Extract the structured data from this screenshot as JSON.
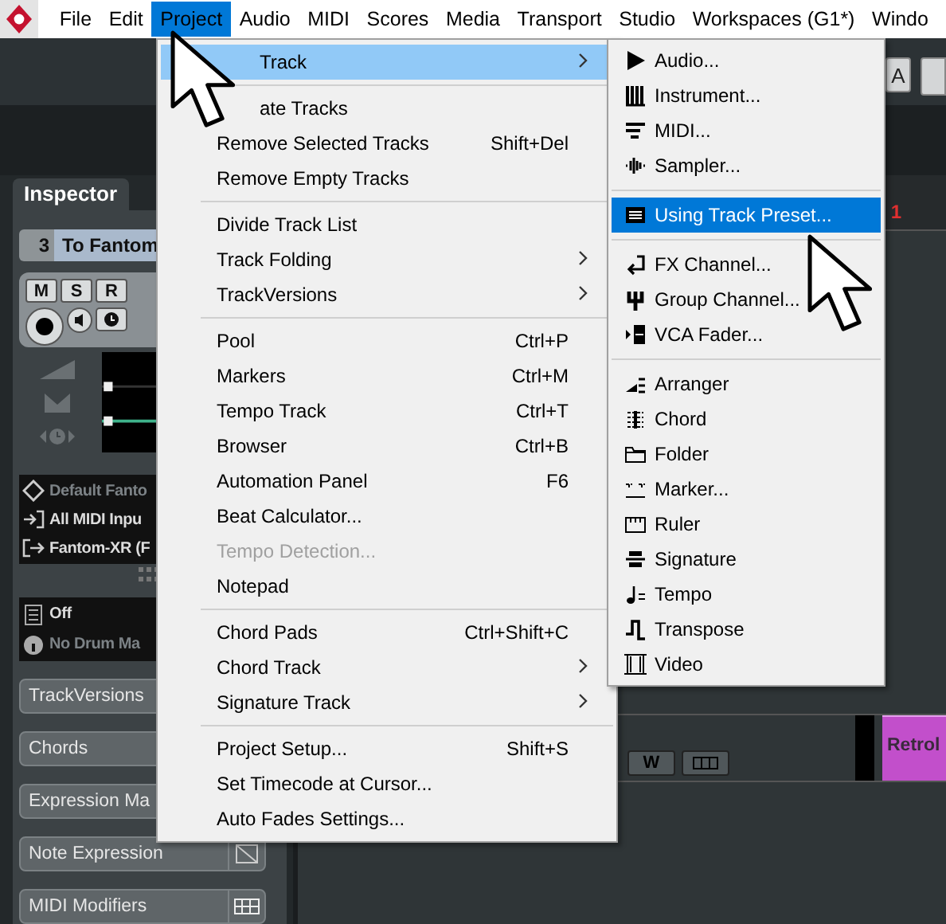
{
  "menu_bar": [
    {
      "label": "File",
      "selected": false
    },
    {
      "label": "Edit",
      "selected": false
    },
    {
      "label": "Project",
      "selected": true
    },
    {
      "label": "Audio",
      "selected": false
    },
    {
      "label": "MIDI",
      "selected": false
    },
    {
      "label": "Scores",
      "selected": false
    },
    {
      "label": "Media",
      "selected": false
    },
    {
      "label": "Transport",
      "selected": false
    },
    {
      "label": "Studio",
      "selected": false
    },
    {
      "label": "Workspaces (G1*)",
      "selected": false
    },
    {
      "label": "Windo",
      "selected": false
    }
  ],
  "toolbar": {
    "buttons": [
      "A"
    ]
  },
  "inspector": {
    "tabs": [
      {
        "label": "Inspector",
        "selected": true
      }
    ],
    "track": {
      "number": "3",
      "name": "To Fantom"
    },
    "channel_buttons": [
      "M",
      "S",
      "R"
    ],
    "routing": [
      {
        "label": "Default Fanto",
        "disabled": true
      },
      {
        "label": "All MIDI Inpu",
        "disabled": false
      },
      {
        "label": "Fantom-XR (F",
        "disabled": false
      }
    ],
    "drum": [
      {
        "label": "Off",
        "disabled": false
      },
      {
        "label": "No Drum Ma",
        "disabled": true
      }
    ],
    "sections": [
      {
        "label": "TrackVersions",
        "kind": "plain"
      },
      {
        "label": "Chords",
        "kind": "plain"
      },
      {
        "label": "Expression Ma",
        "kind": "plain"
      },
      {
        "label": "Note Expression",
        "kind": "hatch"
      },
      {
        "label": "MIDI Modifiers",
        "kind": "grid"
      }
    ]
  },
  "ruler": {
    "marks": [
      "1"
    ]
  },
  "track_row": {
    "buttons": [
      "W"
    ]
  },
  "clip": {
    "label": "Retrol"
  },
  "project_menu": [
    {
      "kind": "item",
      "label": "Track",
      "submenu": true,
      "selected": true,
      "disabled": false,
      "covered": true
    },
    {
      "kind": "separator"
    },
    {
      "kind": "item",
      "label": "ate Tracks",
      "selected": false,
      "disabled": false,
      "covered": true
    },
    {
      "kind": "item",
      "label": "Remove Selected Tracks",
      "shortcut": "Shift+Del",
      "selected": false,
      "disabled": false
    },
    {
      "kind": "item",
      "label": "Remove Empty Tracks",
      "selected": false,
      "disabled": false
    },
    {
      "kind": "separator"
    },
    {
      "kind": "item",
      "label": "Divide Track List",
      "selected": false,
      "disabled": false
    },
    {
      "kind": "item",
      "label": "Track Folding",
      "submenu": true,
      "selected": false,
      "disabled": false
    },
    {
      "kind": "item",
      "label": "TrackVersions",
      "submenu": true,
      "selected": false,
      "disabled": false
    },
    {
      "kind": "separator"
    },
    {
      "kind": "item",
      "label": "Pool",
      "shortcut": "Ctrl+P",
      "selected": false,
      "disabled": false
    },
    {
      "kind": "item",
      "label": "Markers",
      "shortcut": "Ctrl+M",
      "selected": false,
      "disabled": false
    },
    {
      "kind": "item",
      "label": "Tempo Track",
      "shortcut": "Ctrl+T",
      "selected": false,
      "disabled": false
    },
    {
      "kind": "item",
      "label": "Browser",
      "shortcut": "Ctrl+B",
      "selected": false,
      "disabled": false
    },
    {
      "kind": "item",
      "label": "Automation Panel",
      "shortcut": "F6",
      "selected": false,
      "disabled": false
    },
    {
      "kind": "item",
      "label": "Beat Calculator...",
      "selected": false,
      "disabled": false
    },
    {
      "kind": "item",
      "label": "Tempo Detection...",
      "selected": false,
      "disabled": true
    },
    {
      "kind": "item",
      "label": "Notepad",
      "selected": false,
      "disabled": false
    },
    {
      "kind": "separator"
    },
    {
      "kind": "item",
      "label": "Chord Pads",
      "shortcut": "Ctrl+Shift+C",
      "selected": false,
      "disabled": false
    },
    {
      "kind": "item",
      "label": "Chord Track",
      "submenu": true,
      "selected": false,
      "disabled": false
    },
    {
      "kind": "item",
      "label": "Signature Track",
      "submenu": true,
      "selected": false,
      "disabled": false
    },
    {
      "kind": "separator"
    },
    {
      "kind": "item",
      "label": "Project Setup...",
      "shortcut": "Shift+S",
      "selected": false,
      "disabled": false
    },
    {
      "kind": "item",
      "label": "Set Timecode at Cursor...",
      "selected": false,
      "disabled": false
    },
    {
      "kind": "item",
      "label": "Auto Fades Settings...",
      "selected": false,
      "disabled": false
    }
  ],
  "add_track_menu": [
    {
      "kind": "item",
      "label": "Audio...",
      "selected": false
    },
    {
      "kind": "item",
      "label": "Instrument...",
      "selected": false
    },
    {
      "kind": "item",
      "label": "MIDI...",
      "selected": false
    },
    {
      "kind": "item",
      "label": "Sampler...",
      "selected": false
    },
    {
      "kind": "separator"
    },
    {
      "kind": "item",
      "label": "Using Track Preset...",
      "selected": true
    },
    {
      "kind": "separator"
    },
    {
      "kind": "item",
      "label": "FX Channel...",
      "selected": false
    },
    {
      "kind": "item",
      "label": "Group Channel...",
      "selected": false
    },
    {
      "kind": "item",
      "label": "VCA Fader...",
      "selected": false
    },
    {
      "kind": "separator"
    },
    {
      "kind": "item",
      "label": "Arranger",
      "selected": false
    },
    {
      "kind": "item",
      "label": "Chord",
      "selected": false
    },
    {
      "kind": "item",
      "label": "Folder",
      "selected": false
    },
    {
      "kind": "item",
      "label": "Marker...",
      "selected": false
    },
    {
      "kind": "item",
      "label": "Ruler",
      "selected": false
    },
    {
      "kind": "item",
      "label": "Signature",
      "selected": false
    },
    {
      "kind": "item",
      "label": "Tempo",
      "selected": false
    },
    {
      "kind": "item",
      "label": "Transpose",
      "selected": false
    },
    {
      "kind": "item",
      "label": "Video",
      "selected": false
    }
  ]
}
